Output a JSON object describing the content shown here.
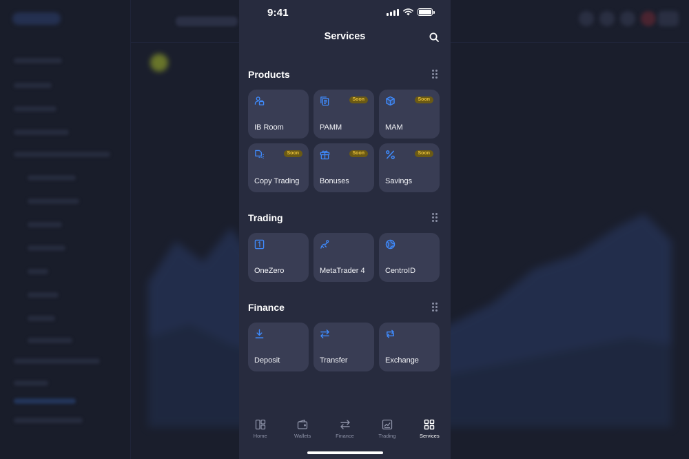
{
  "status_bar": {
    "time": "9:41"
  },
  "header": {
    "title": "Services",
    "search_icon": "search-icon"
  },
  "sections": [
    {
      "title": "Products",
      "tiles": [
        {
          "label": "IB Room",
          "icon": "user-group-icon",
          "badge": ""
        },
        {
          "label": "PAMM",
          "icon": "document-copy-icon",
          "badge": "Soon"
        },
        {
          "label": "MAM",
          "icon": "cube-icon",
          "badge": "Soon"
        },
        {
          "label": "Copy Trading",
          "icon": "copy-trading-icon",
          "badge": "Soon"
        },
        {
          "label": "Bonuses",
          "icon": "gift-icon",
          "badge": "Soon"
        },
        {
          "label": "Savings",
          "icon": "percent-icon",
          "badge": "Soon"
        }
      ]
    },
    {
      "title": "Trading",
      "tiles": [
        {
          "label": "OneZero",
          "icon": "onezero-icon",
          "badge": ""
        },
        {
          "label": "MetaTrader 4",
          "icon": "metatrader-icon",
          "badge": ""
        },
        {
          "label": "CentroID",
          "icon": "globe-icon",
          "badge": ""
        }
      ]
    },
    {
      "title": "Finance",
      "tiles": [
        {
          "label": "Deposit",
          "icon": "download-icon",
          "badge": ""
        },
        {
          "label": "Transfer",
          "icon": "transfer-arrows-icon",
          "badge": ""
        },
        {
          "label": "Exchange",
          "icon": "exchange-cycle-icon",
          "badge": ""
        }
      ]
    }
  ],
  "tabbar": {
    "items": [
      {
        "label": "Home",
        "icon": "home-dashboard-icon",
        "active": false
      },
      {
        "label": "Wallets",
        "icon": "wallet-icon",
        "active": false
      },
      {
        "label": "Finance",
        "icon": "transfer-arrows-icon",
        "active": false
      },
      {
        "label": "Trading",
        "icon": "chart-icon",
        "active": false
      },
      {
        "label": "Services",
        "icon": "grid-icon",
        "active": true
      }
    ]
  },
  "colors": {
    "panel_bg": "#272b3e",
    "tile_bg": "#393d54",
    "accent_icon": "#3f8cff",
    "badge_bg": "#6b5a14",
    "badge_text": "#e8c03a",
    "tab_inactive": "#8d92a7"
  }
}
